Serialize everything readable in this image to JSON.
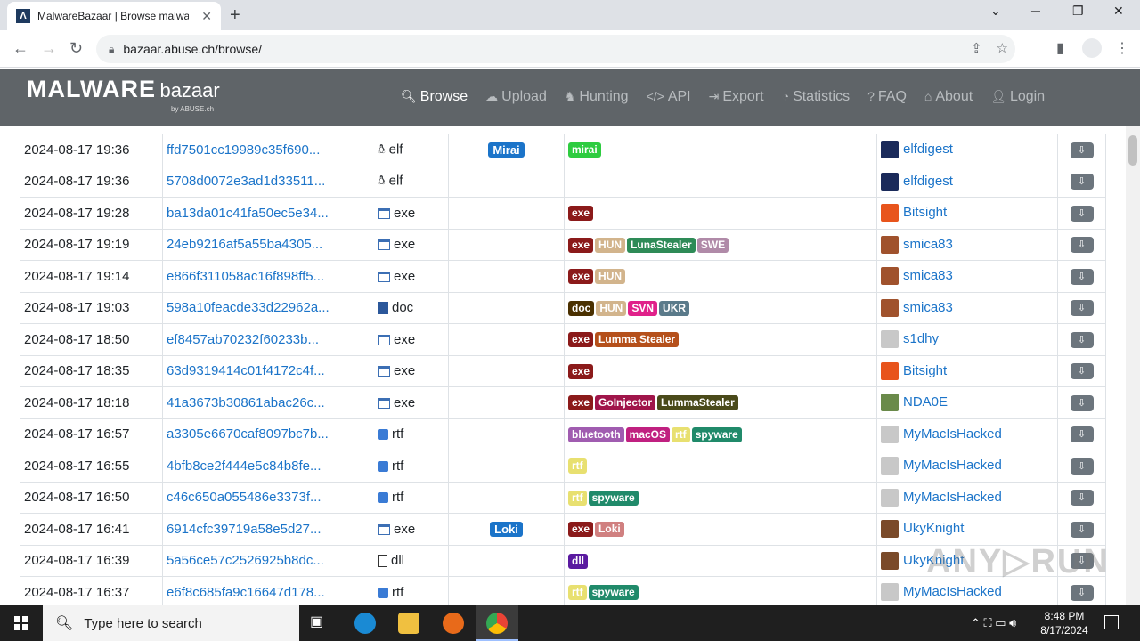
{
  "browser": {
    "tab_title": "MalwareBazaar | Browse malware",
    "url": "bazaar.abuse.ch/browse/"
  },
  "site": {
    "brand_main": "MALWARE",
    "brand_sub": "bazaar",
    "brand_by": "by ABUSE.ch",
    "nav": [
      {
        "label": "Browse",
        "icon": "search-icon"
      },
      {
        "label": "Upload",
        "icon": "cloud-upload-icon"
      },
      {
        "label": "Hunting",
        "icon": "hunting-icon"
      },
      {
        "label": "API",
        "icon": "code-icon"
      },
      {
        "label": "Export",
        "icon": "export-icon"
      },
      {
        "label": "Statistics",
        "icon": "pie-chart-icon"
      },
      {
        "label": "FAQ",
        "icon": "question-icon"
      },
      {
        "label": "About",
        "icon": "building-icon"
      },
      {
        "label": "Login",
        "icon": "user-icon"
      }
    ]
  },
  "rows": [
    {
      "date": "2024-08-17 19:36",
      "hash": "ffd7501cc19989c35f690...",
      "type": "elf",
      "ftype": "elf",
      "sig": "Mirai",
      "tags": [
        {
          "t": "mirai",
          "c": "#2ecc40"
        }
      ],
      "rep": "elfdigest",
      "av": "#1a2a5a"
    },
    {
      "date": "2024-08-17 19:36",
      "hash": "5708d0072e3ad1d33511...",
      "type": "elf",
      "ftype": "elf",
      "sig": "",
      "tags": [],
      "rep": "elfdigest",
      "av": "#1a2a5a"
    },
    {
      "date": "2024-08-17 19:28",
      "hash": "ba13da01c41fa50ec5e34...",
      "type": "exe",
      "ftype": "exe",
      "sig": "",
      "tags": [
        {
          "t": "exe",
          "c": "#8b1a1a"
        }
      ],
      "rep": "Bitsight",
      "av": "#e8541c"
    },
    {
      "date": "2024-08-17 19:19",
      "hash": "24eb9216af5a55ba4305...",
      "type": "exe",
      "ftype": "exe",
      "sig": "",
      "tags": [
        {
          "t": "exe",
          "c": "#8b1a1a"
        },
        {
          "t": "HUN",
          "c": "#d2b48c"
        },
        {
          "t": "LunaStealer",
          "c": "#2e8b57"
        },
        {
          "t": "SWE",
          "c": "#b08aa8"
        }
      ],
      "rep": "smica83",
      "av": "#a0522d"
    },
    {
      "date": "2024-08-17 19:14",
      "hash": "e866f311058ac16f898ff5...",
      "type": "exe",
      "ftype": "exe",
      "sig": "",
      "tags": [
        {
          "t": "exe",
          "c": "#8b1a1a"
        },
        {
          "t": "HUN",
          "c": "#d2b48c"
        }
      ],
      "rep": "smica83",
      "av": "#a0522d"
    },
    {
      "date": "2024-08-17 19:03",
      "hash": "598a10feacde33d22962a...",
      "type": "doc",
      "ftype": "doc",
      "sig": "",
      "tags": [
        {
          "t": "doc",
          "c": "#4a3000"
        },
        {
          "t": "HUN",
          "c": "#d2b48c"
        },
        {
          "t": "SVN",
          "c": "#e0218a"
        },
        {
          "t": "UKR",
          "c": "#5a7a8a"
        }
      ],
      "rep": "smica83",
      "av": "#a0522d"
    },
    {
      "date": "2024-08-17 18:50",
      "hash": "ef8457ab70232f60233b...",
      "type": "exe",
      "ftype": "exe",
      "sig": "",
      "tags": [
        {
          "t": "exe",
          "c": "#8b1a1a"
        },
        {
          "t": "Lumma Stealer",
          "c": "#b5501b"
        }
      ],
      "rep": "s1dhy",
      "av": "#c8c8c8"
    },
    {
      "date": "2024-08-17 18:35",
      "hash": "63d9319414c01f4172c4f...",
      "type": "exe",
      "ftype": "exe",
      "sig": "",
      "tags": [
        {
          "t": "exe",
          "c": "#8b1a1a"
        }
      ],
      "rep": "Bitsight",
      "av": "#e8541c"
    },
    {
      "date": "2024-08-17 18:18",
      "hash": "41a3673b30861abac26c...",
      "type": "exe",
      "ftype": "exe",
      "sig": "",
      "tags": [
        {
          "t": "exe",
          "c": "#8b1a1a"
        },
        {
          "t": "GoInjector",
          "c": "#a0154a"
        },
        {
          "t": "LummaStealer",
          "c": "#4a4a1a"
        }
      ],
      "rep": "NDA0E",
      "av": "#6a8a4a"
    },
    {
      "date": "2024-08-17 16:57",
      "hash": "a3305e6670caf8097bc7b...",
      "type": "rtf",
      "ftype": "rtf",
      "sig": "",
      "tags": [
        {
          "t": "bluetooth",
          "c": "#a05cb0"
        },
        {
          "t": "macOS",
          "c": "#c02080"
        },
        {
          "t": "rtf",
          "c": "#e8e070"
        },
        {
          "t": "spyware",
          "c": "#208a6a"
        }
      ],
      "rep": "MyMacIsHacked",
      "av": "#c8c8c8"
    },
    {
      "date": "2024-08-17 16:55",
      "hash": "4bfb8ce2f444e5c84b8fe...",
      "type": "rtf",
      "ftype": "rtf",
      "sig": "",
      "tags": [
        {
          "t": "rtf",
          "c": "#e8e070"
        }
      ],
      "rep": "MyMacIsHacked",
      "av": "#c8c8c8"
    },
    {
      "date": "2024-08-17 16:50",
      "hash": "c46c650a055486e3373f...",
      "type": "rtf",
      "ftype": "rtf",
      "sig": "",
      "tags": [
        {
          "t": "rtf",
          "c": "#e8e070"
        },
        {
          "t": "spyware",
          "c": "#208a6a"
        }
      ],
      "rep": "MyMacIsHacked",
      "av": "#c8c8c8"
    },
    {
      "date": "2024-08-17 16:41",
      "hash": "6914cfc39719a58e5d27...",
      "type": "exe",
      "ftype": "exe",
      "sig": "Loki",
      "tags": [
        {
          "t": "exe",
          "c": "#8b1a1a"
        },
        {
          "t": "Loki",
          "c": "#d08080"
        }
      ],
      "rep": "UkyKnight",
      "av": "#7a4a2a"
    },
    {
      "date": "2024-08-17 16:39",
      "hash": "5a56ce57c2526925b8dc...",
      "type": "dll",
      "ftype": "dll",
      "sig": "",
      "tags": [
        {
          "t": "dll",
          "c": "#5a1aa0"
        }
      ],
      "rep": "UkyKnight",
      "av": "#7a4a2a"
    },
    {
      "date": "2024-08-17 16:37",
      "hash": "e6f8c685fa9c16647d178...",
      "type": "rtf",
      "ftype": "rtf",
      "sig": "",
      "tags": [
        {
          "t": "rtf",
          "c": "#e8e070"
        },
        {
          "t": "spyware",
          "c": "#208a6a"
        }
      ],
      "rep": "MyMacIsHacked",
      "av": "#c8c8c8"
    }
  ],
  "taskbar": {
    "search_placeholder": "Type here to search",
    "time": "8:48 PM",
    "date": "8/17/2024"
  }
}
